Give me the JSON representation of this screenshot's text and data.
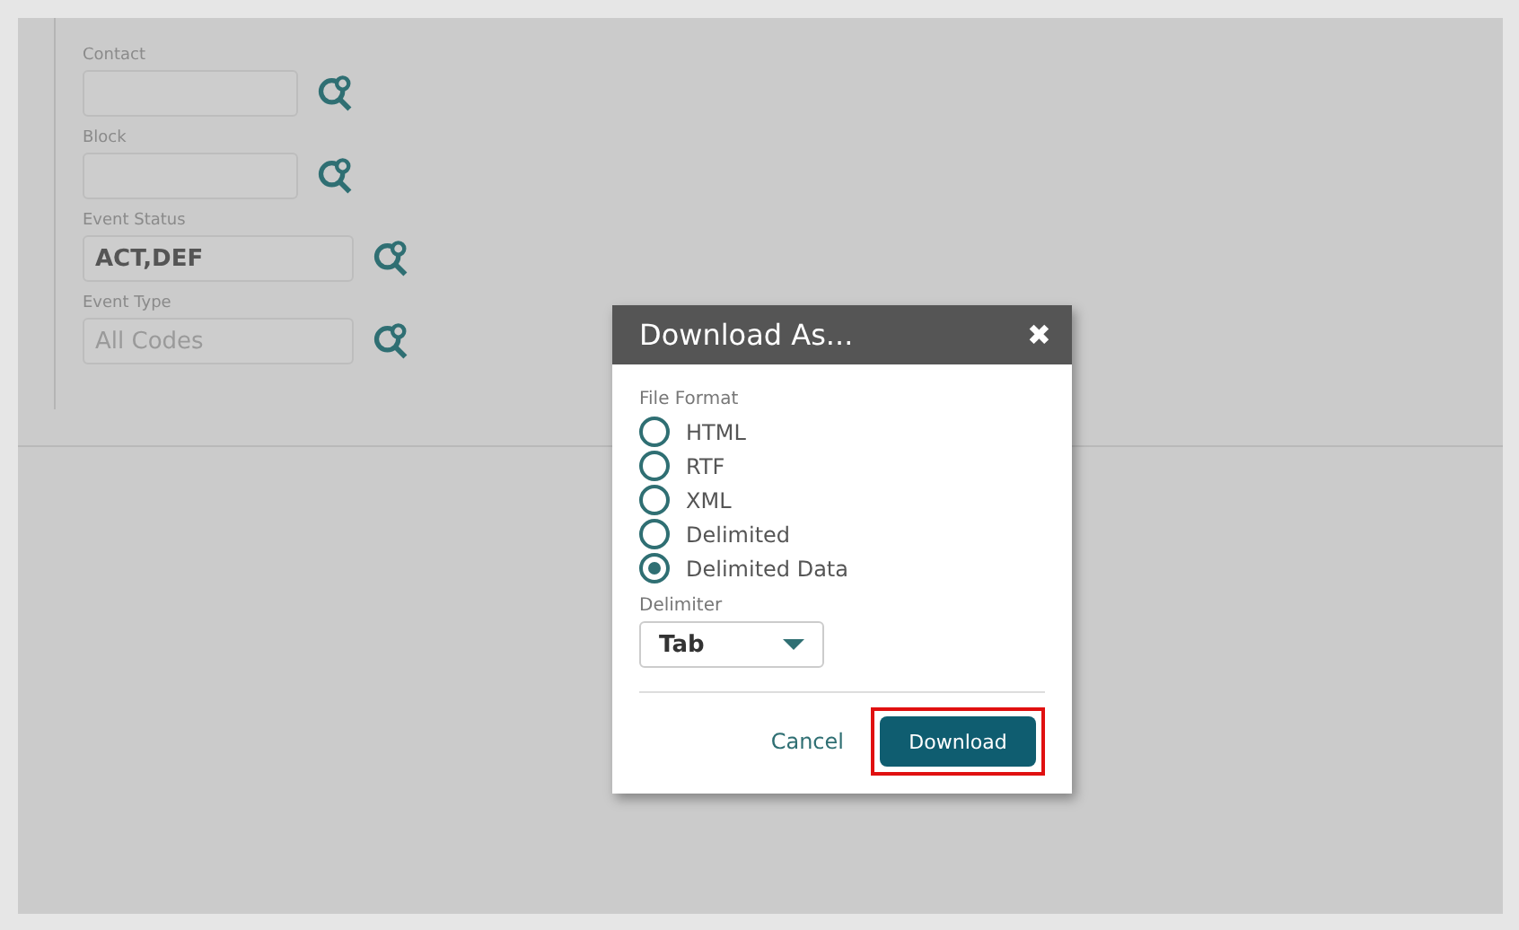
{
  "form": {
    "fields": [
      {
        "label": "Contact",
        "kind": "text"
      },
      {
        "label": "Block",
        "kind": "text"
      },
      {
        "label": "Event Status",
        "kind": "area",
        "value": "ACT,DEF"
      },
      {
        "label": "Event Type",
        "kind": "area",
        "placeholder": "All Codes"
      }
    ]
  },
  "dialog": {
    "title": "Download As...",
    "close": "✖",
    "format_label": "File Format",
    "formats": [
      {
        "label": "HTML",
        "selected": false
      },
      {
        "label": "RTF",
        "selected": false
      },
      {
        "label": "XML",
        "selected": false
      },
      {
        "label": "Delimited",
        "selected": false
      },
      {
        "label": "Delimited Data",
        "selected": true
      }
    ],
    "delimiter_label": "Delimiter",
    "delimiter": "Tab",
    "buttons": [
      {
        "label": "Cancel",
        "kind": "link",
        "highlighted": false
      },
      {
        "label": "Download",
        "kind": "primary",
        "highlighted": true
      }
    ]
  }
}
